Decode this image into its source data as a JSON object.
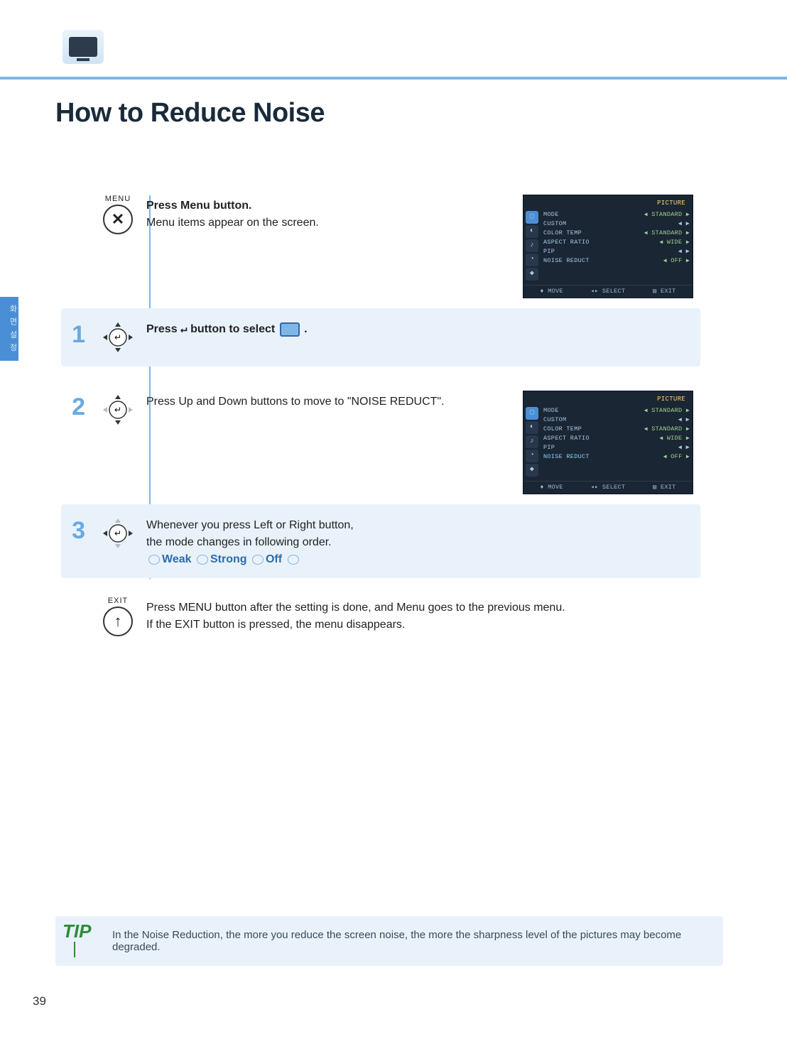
{
  "page": {
    "title": "How to Reduce Noise",
    "number": "39"
  },
  "side_tab": "화 면 설 정",
  "menu_button": {
    "label": "MENU"
  },
  "exit_button": {
    "label": "EXIT"
  },
  "step_menu": {
    "line_bold": "Press Menu button.",
    "line2": "Menu items appear on the screen."
  },
  "step1": {
    "num": "1",
    "pre": "Press ",
    "post": " button to select ",
    "tail": " ."
  },
  "step2": {
    "num": "2",
    "text": "Press Up and Down buttons to move to  \"NOISE REDUCT\"."
  },
  "step3": {
    "num": "3",
    "line1": "Whenever you press Left or Right button,",
    "line2": "the mode changes in following order.",
    "cycle": [
      "Weak",
      "Strong",
      "Off"
    ]
  },
  "step_exit": {
    "line1": "Press MENU button after the setting is done, and Menu goes to the previous menu.",
    "line2": "If the EXIT button is pressed, the menu disappears."
  },
  "osd": {
    "title": "PICTURE",
    "rows": [
      {
        "k": "MODE",
        "v": "STANDARD"
      },
      {
        "k": "CUSTOM",
        "v": "◀ ▶"
      },
      {
        "k": "COLOR TEMP",
        "v": "STANDARD"
      },
      {
        "k": "ASPECT RATIO",
        "v": "WIDE"
      },
      {
        "k": "PIP",
        "v": "◀ ▶"
      },
      {
        "k": "NOISE REDUCT",
        "v": "OFF"
      }
    ],
    "foot": {
      "move": "MOVE",
      "select": "SELECT",
      "exit": "EXIT"
    }
  },
  "tip": {
    "badge": "TIP",
    "text": "In the Noise Reduction, the more you reduce the screen noise, the more the sharpness level of the pictures may become degraded."
  }
}
